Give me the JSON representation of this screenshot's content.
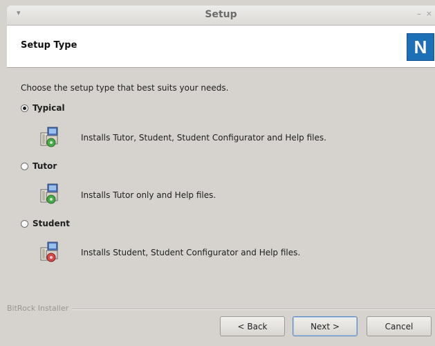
{
  "window": {
    "title": "Setup",
    "menu_glyph": "▾",
    "minimize_glyph": "–",
    "close_glyph": "×"
  },
  "header": {
    "title": "Setup Type",
    "logo_letter": "N",
    "logo_color": "#1d6fb6"
  },
  "main": {
    "prompt": "Choose the setup type that best suits your needs.",
    "options": [
      {
        "label": "Typical",
        "description": "Installs Tutor, Student, Student Configurator and Help files.",
        "selected": true,
        "icon": "installer-package-icon"
      },
      {
        "label": "Tutor",
        "description": "Installs Tutor only and Help files.",
        "selected": false,
        "icon": "installer-package-icon"
      },
      {
        "label": "Student",
        "description": "Installs Student, Student Configurator and Help files.",
        "selected": false,
        "icon": "installer-package-icon"
      }
    ]
  },
  "footer": {
    "brand": "BitRock Installer",
    "back_label": "< Back",
    "next_label": "Next >",
    "cancel_label": "Cancel"
  }
}
